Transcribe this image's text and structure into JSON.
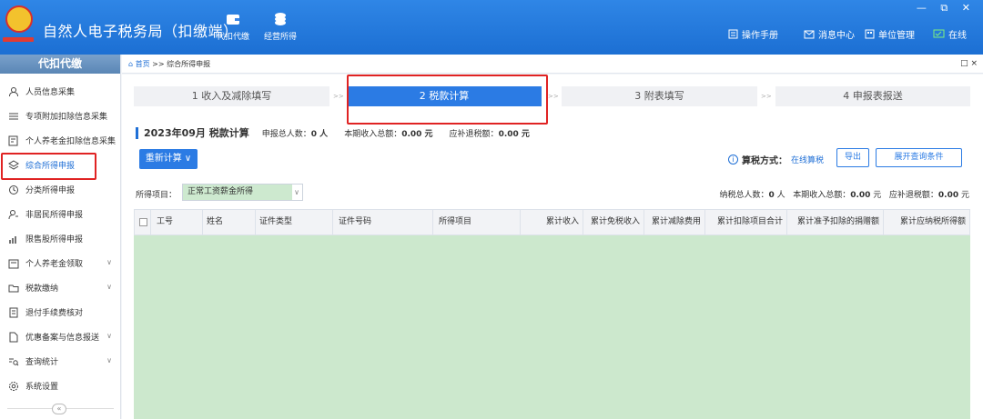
{
  "app": {
    "title": "自然人电子税务局（扣缴端）",
    "tools": [
      {
        "label": "代扣代缴"
      },
      {
        "label": "经营所得"
      }
    ],
    "right_menu": [
      {
        "label": "操作手册"
      },
      {
        "label": "消息中心"
      },
      {
        "label": "单位管理"
      },
      {
        "label": "在线"
      }
    ],
    "window_controls": "— ⧉ ✕"
  },
  "sidebar": {
    "header": "代扣代缴",
    "items": [
      {
        "label": "人员信息采集",
        "icon": "person-icon"
      },
      {
        "label": "专项附加扣除信息采集",
        "icon": "list-icon"
      },
      {
        "label": "个人养老金扣除信息采集",
        "icon": "doc-plus-icon"
      },
      {
        "label": "综合所得申报",
        "icon": "layers-icon"
      },
      {
        "label": "分类所得申报",
        "icon": "clock-icon"
      },
      {
        "label": "非居民所得申报",
        "icon": "person-outline-icon"
      },
      {
        "label": "限售股所得申报",
        "icon": "bar-chart-icon"
      },
      {
        "label": "个人养老金领取",
        "icon": "wallet-icon"
      },
      {
        "label": "税款缴纳",
        "icon": "folder-icon"
      },
      {
        "label": "退付手续费核对",
        "icon": "receipt-icon"
      },
      {
        "label": "优惠备案与信息报送",
        "icon": "file-icon"
      },
      {
        "label": "查询统计",
        "icon": "query-icon"
      },
      {
        "label": "系统设置",
        "icon": "gear-icon"
      }
    ],
    "collapse": "«"
  },
  "breadcrumb": {
    "home": "首页",
    "sep": " >> ",
    "current": "综合所得申报",
    "close": "□ ×"
  },
  "steps": [
    {
      "label": "1 收入及减除填写"
    },
    {
      "label": "2 税款计算"
    },
    {
      "label": "3 附表填写"
    },
    {
      "label": "4 申报表报送"
    }
  ],
  "step_sep": ">>",
  "summary": {
    "title": "2023年09月  税款计算",
    "declare_count_label": "申报总人数：",
    "declare_count": "0 人",
    "income_label": "本期收入总额：",
    "income": "0.00 元",
    "refund_label": "应补退税额：",
    "refund": "0.00 元"
  },
  "actions": {
    "recalc": "重新计算 ∨",
    "tax_method_label": "算税方式：",
    "tax_method_value": "在线算税",
    "export": "导出",
    "expand": "展开查询条件"
  },
  "filter": {
    "label": "所得项目：",
    "selected": "正常工资薪金所得",
    "arrow": "∨"
  },
  "stats": {
    "taxpayers_label": "纳税总人数：",
    "taxpayers": "0",
    "taxpayers_unit": " 人",
    "income_label": "本期收入总额：",
    "income": "0.00",
    "income_unit": " 元",
    "refund_label": "应补退税额：",
    "refund": "0.00",
    "refund_unit": " 元"
  },
  "table": {
    "columns": [
      "工号",
      "姓名",
      "证件类型",
      "证件号码",
      "所得项目",
      "累计收入",
      "累计免税收入",
      "累计减除费用",
      "累计扣除项目合计",
      "累计准予扣除的捐赠额",
      "累计应纳税所得额"
    ]
  },
  "colors": {
    "primary": "#2b7be4",
    "highlight": "#e02323",
    "table_body": "#cce8cd"
  }
}
